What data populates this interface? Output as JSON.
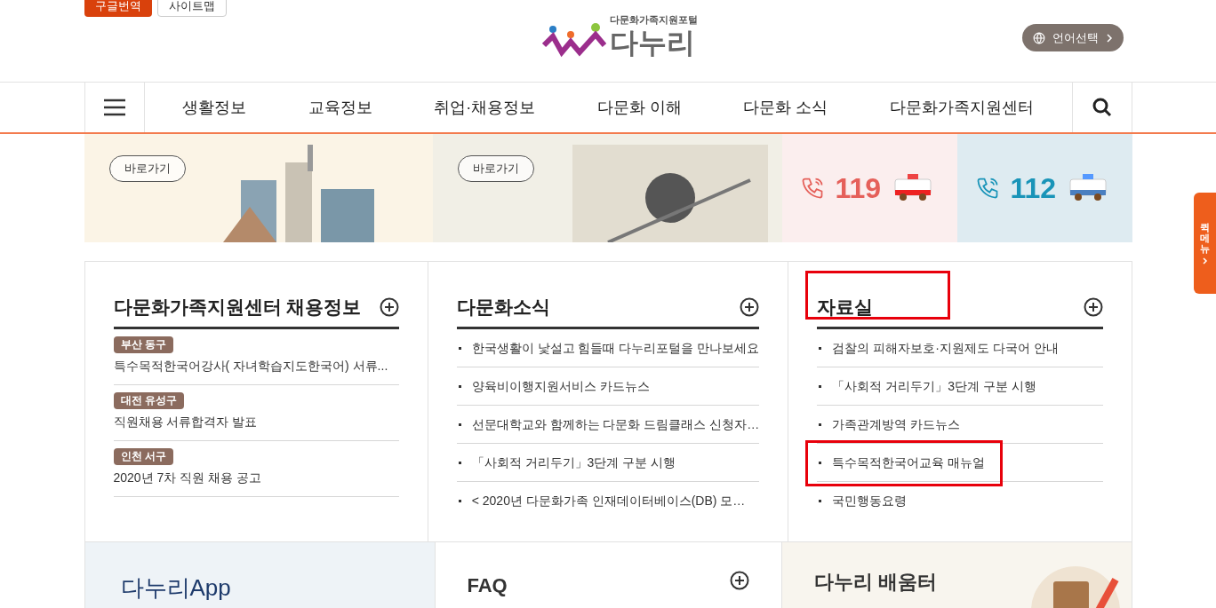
{
  "top_buttons": [
    {
      "label": "구글번역",
      "kind": "primary"
    },
    {
      "label": "사이트맵",
      "kind": "outline"
    }
  ],
  "logo": {
    "tagline": "다문화가족지원포털",
    "name": "다누리"
  },
  "language_button": {
    "label": "언어선택"
  },
  "nav": {
    "items": [
      "생활정보",
      "교육정보",
      "취업·채용정보",
      "다문화 이해",
      "다문화 소식",
      "다문화가족지원센터"
    ]
  },
  "banner": [
    {
      "kind": "link",
      "button": "바로가기"
    },
    {
      "kind": "link",
      "button": "바로가기"
    },
    {
      "kind": "call",
      "number": "119",
      "color": "#e5605a"
    },
    {
      "kind": "call",
      "number": "112",
      "color": "#1994b8"
    }
  ],
  "panels": [
    {
      "kind": "jobs",
      "title": "다문화가족지원센터 채용정보",
      "highlighted": false,
      "items": [
        {
          "tag": "부산 동구",
          "text": "특수목적한국어강사( 자녀학습지도한국어) 서류...",
          "highlighted": false
        },
        {
          "tag": "대전 유성구",
          "text": "직원채용 서류합격자 발표",
          "highlighted": false
        },
        {
          "tag": "인천 서구",
          "text": "2020년 7차 직원 채용 공고",
          "highlighted": false
        }
      ]
    },
    {
      "kind": "list",
      "title": "다문화소식",
      "highlighted": false,
      "items": [
        {
          "text": "한국생활이 낯설고 힘들때 다누리포털을 만나보세요",
          "highlighted": false
        },
        {
          "text": "양육비이행지원서비스 카드뉴스",
          "highlighted": false
        },
        {
          "text": "선문대학교와 함께하는 다문화 드림클래스 신청자…",
          "highlighted": false
        },
        {
          "text": "「사회적 거리두기」3단계 구분 시행",
          "highlighted": false
        },
        {
          "text": "< 2020년 다문화가족 인재데이터베이스(DB) 모…",
          "highlighted": false
        }
      ]
    },
    {
      "kind": "list",
      "title": "자료실",
      "highlighted": true,
      "items": [
        {
          "text": "검찰의 피해자보호·지원제도 다국어 안내",
          "highlighted": false
        },
        {
          "text": "「사회적 거리두기」3단계 구분 시행",
          "highlighted": false
        },
        {
          "text": "가족관계방역 카드뉴스",
          "highlighted": false
        },
        {
          "text": "특수목적한국어교육 매뉴얼",
          "highlighted": true
        },
        {
          "text": "국민행동요령",
          "highlighted": false
        }
      ]
    }
  ],
  "bottom_panels": [
    {
      "kind": "app",
      "title": "다누리App"
    },
    {
      "kind": "faq",
      "title": "FAQ"
    },
    {
      "kind": "learn",
      "title": "다누리 배움터"
    }
  ],
  "quick_menu": {
    "label": "퀵메뉴"
  }
}
